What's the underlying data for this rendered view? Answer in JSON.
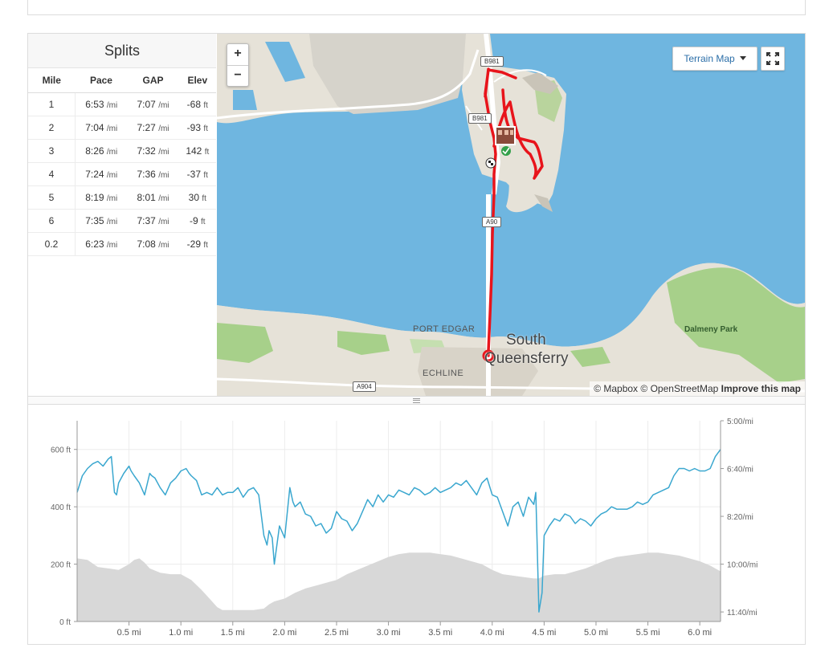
{
  "splits": {
    "title": "Splits",
    "headers": [
      "Mile",
      "Pace",
      "GAP",
      "Elev"
    ],
    "rows": [
      {
        "mile": "1",
        "pace": "6:53",
        "pace_unit": "/mi",
        "gap": "7:07",
        "gap_unit": "/mi",
        "elev": "-68",
        "elev_unit": "ft"
      },
      {
        "mile": "2",
        "pace": "7:04",
        "pace_unit": "/mi",
        "gap": "7:27",
        "gap_unit": "/mi",
        "elev": "-93",
        "elev_unit": "ft"
      },
      {
        "mile": "3",
        "pace": "8:26",
        "pace_unit": "/mi",
        "gap": "7:32",
        "gap_unit": "/mi",
        "elev": "142",
        "elev_unit": "ft"
      },
      {
        "mile": "4",
        "pace": "7:24",
        "pace_unit": "/mi",
        "gap": "7:36",
        "gap_unit": "/mi",
        "elev": "-37",
        "elev_unit": "ft"
      },
      {
        "mile": "5",
        "pace": "8:19",
        "pace_unit": "/mi",
        "gap": "8:01",
        "gap_unit": "/mi",
        "elev": "30",
        "elev_unit": "ft"
      },
      {
        "mile": "6",
        "pace": "7:35",
        "pace_unit": "/mi",
        "gap": "7:37",
        "gap_unit": "/mi",
        "elev": "-9",
        "elev_unit": "ft"
      },
      {
        "mile": "0.2",
        "pace": "6:23",
        "pace_unit": "/mi",
        "gap": "7:08",
        "gap_unit": "/mi",
        "elev": "-29",
        "elev_unit": "ft"
      }
    ]
  },
  "map": {
    "zoom_in": "+",
    "zoom_out": "−",
    "map_type": "Terrain Map",
    "attribution_mapbox": "© Mapbox",
    "attribution_osm": "© OpenStreetMap",
    "attribution_improve": "Improve this map",
    "labels": {
      "port_edgar": "PORT EDGAR",
      "town_line1": "South",
      "town_line2": "Queensferry",
      "echline": "ECHLINE",
      "dalmeny_park": "Dalmeny Park"
    },
    "roads": [
      "B981",
      "B981",
      "A90",
      "A904"
    ],
    "colors": {
      "water": "#6fb6e0",
      "land": "#e6e2d8",
      "park": "#a7d08a",
      "route": "#e8141b"
    }
  },
  "chart_data": {
    "type": "line",
    "x_ticks": [
      "0.5 mi",
      "1.0 mi",
      "1.5 mi",
      "2.0 mi",
      "2.5 mi",
      "3.0 mi",
      "3.5 mi",
      "4.0 mi",
      "4.5 mi",
      "5.0 mi",
      "5.5 mi",
      "6.0 mi"
    ],
    "xlim": [
      0,
      6.2
    ],
    "y_left_ticks": [
      "0 ft",
      "200 ft",
      "400 ft",
      "600 ft"
    ],
    "y_left_lim": [
      0,
      700
    ],
    "y_right_ticks": [
      "5:00/mi",
      "6:40/mi",
      "8:20/mi",
      "10:00/mi",
      "11:40/mi"
    ],
    "y_right_lim_sec_per_mi": [
      300,
      720
    ],
    "grid": true,
    "series": [
      {
        "unit": "sec_per_mi",
        "color": "#3aa7cf",
        "x": [
          0.0,
          0.05,
          0.1,
          0.15,
          0.2,
          0.25,
          0.3,
          0.33,
          0.36,
          0.38,
          0.4,
          0.45,
          0.5,
          0.52,
          0.55,
          0.6,
          0.65,
          0.7,
          0.72,
          0.75,
          0.8,
          0.85,
          0.9,
          0.95,
          1.0,
          1.05,
          1.08,
          1.1,
          1.15,
          1.2,
          1.25,
          1.3,
          1.35,
          1.4,
          1.45,
          1.5,
          1.55,
          1.6,
          1.65,
          1.7,
          1.75,
          1.8,
          1.83,
          1.85,
          1.88,
          1.9,
          1.95,
          2.0,
          2.05,
          2.08,
          2.1,
          2.15,
          2.2,
          2.25,
          2.3,
          2.35,
          2.4,
          2.45,
          2.5,
          2.55,
          2.6,
          2.65,
          2.7,
          2.75,
          2.8,
          2.85,
          2.9,
          2.95,
          3.0,
          3.05,
          3.1,
          3.15,
          3.2,
          3.25,
          3.3,
          3.35,
          3.4,
          3.45,
          3.5,
          3.55,
          3.6,
          3.65,
          3.7,
          3.75,
          3.8,
          3.85,
          3.9,
          3.95,
          4.0,
          4.05,
          4.1,
          4.15,
          4.2,
          4.25,
          4.3,
          4.35,
          4.4,
          4.42,
          4.45,
          4.48,
          4.5,
          4.55,
          4.6,
          4.65,
          4.7,
          4.75,
          4.8,
          4.85,
          4.9,
          4.95,
          5.0,
          5.05,
          5.1,
          5.15,
          5.2,
          5.25,
          5.3,
          5.35,
          5.4,
          5.45,
          5.5,
          5.55,
          5.6,
          5.65,
          5.7,
          5.75,
          5.8,
          5.85,
          5.9,
          5.95,
          6.0,
          6.05,
          6.1,
          6.15,
          6.2
        ],
        "y": [
          450,
          415,
          400,
          390,
          385,
          395,
          380,
          375,
          450,
          455,
          430,
          410,
          395,
          405,
          415,
          430,
          455,
          410,
          415,
          420,
          440,
          455,
          430,
          420,
          405,
          400,
          410,
          415,
          425,
          455,
          450,
          455,
          440,
          455,
          450,
          450,
          440,
          460,
          445,
          440,
          455,
          540,
          560,
          530,
          545,
          600,
          520,
          545,
          440,
          470,
          480,
          470,
          495,
          500,
          520,
          515,
          535,
          525,
          490,
          505,
          510,
          530,
          515,
          490,
          465,
          480,
          455,
          470,
          455,
          460,
          445,
          450,
          455,
          440,
          445,
          455,
          450,
          440,
          450,
          445,
          440,
          430,
          435,
          425,
          440,
          455,
          430,
          420,
          455,
          460,
          490,
          520,
          480,
          470,
          500,
          460,
          475,
          450,
          700,
          660,
          540,
          520,
          505,
          510,
          495,
          500,
          515,
          505,
          510,
          520,
          505,
          495,
          490,
          480,
          485,
          485,
          485,
          480,
          470,
          475,
          470,
          455,
          450,
          445,
          440,
          415,
          400,
          400,
          405,
          400,
          405,
          405,
          400,
          375,
          360
        ]
      },
      {
        "unit": "ft",
        "color": "#d8d8d8",
        "x": [
          0.0,
          0.1,
          0.2,
          0.3,
          0.4,
          0.5,
          0.55,
          0.6,
          0.65,
          0.7,
          0.8,
          0.9,
          1.0,
          1.1,
          1.2,
          1.3,
          1.35,
          1.4,
          1.5,
          1.6,
          1.7,
          1.8,
          1.85,
          1.9,
          2.0,
          2.1,
          2.2,
          2.3,
          2.4,
          2.5,
          2.6,
          2.7,
          2.8,
          2.9,
          3.0,
          3.1,
          3.2,
          3.3,
          3.4,
          3.5,
          3.6,
          3.7,
          3.8,
          3.9,
          4.0,
          4.1,
          4.2,
          4.3,
          4.4,
          4.45,
          4.5,
          4.6,
          4.7,
          4.8,
          4.9,
          5.0,
          5.1,
          5.2,
          5.3,
          5.4,
          5.5,
          5.6,
          5.7,
          5.8,
          5.9,
          6.0,
          6.1,
          6.2
        ],
        "y": [
          220,
          215,
          190,
          185,
          180,
          200,
          215,
          220,
          205,
          185,
          170,
          165,
          165,
          145,
          110,
          70,
          50,
          40,
          40,
          40,
          40,
          45,
          60,
          70,
          80,
          100,
          115,
          125,
          135,
          145,
          165,
          180,
          195,
          210,
          225,
          235,
          240,
          240,
          240,
          235,
          230,
          220,
          210,
          200,
          180,
          165,
          160,
          155,
          150,
          150,
          160,
          165,
          165,
          175,
          185,
          200,
          215,
          225,
          230,
          235,
          240,
          240,
          235,
          230,
          220,
          210,
          195,
          175
        ]
      }
    ]
  }
}
